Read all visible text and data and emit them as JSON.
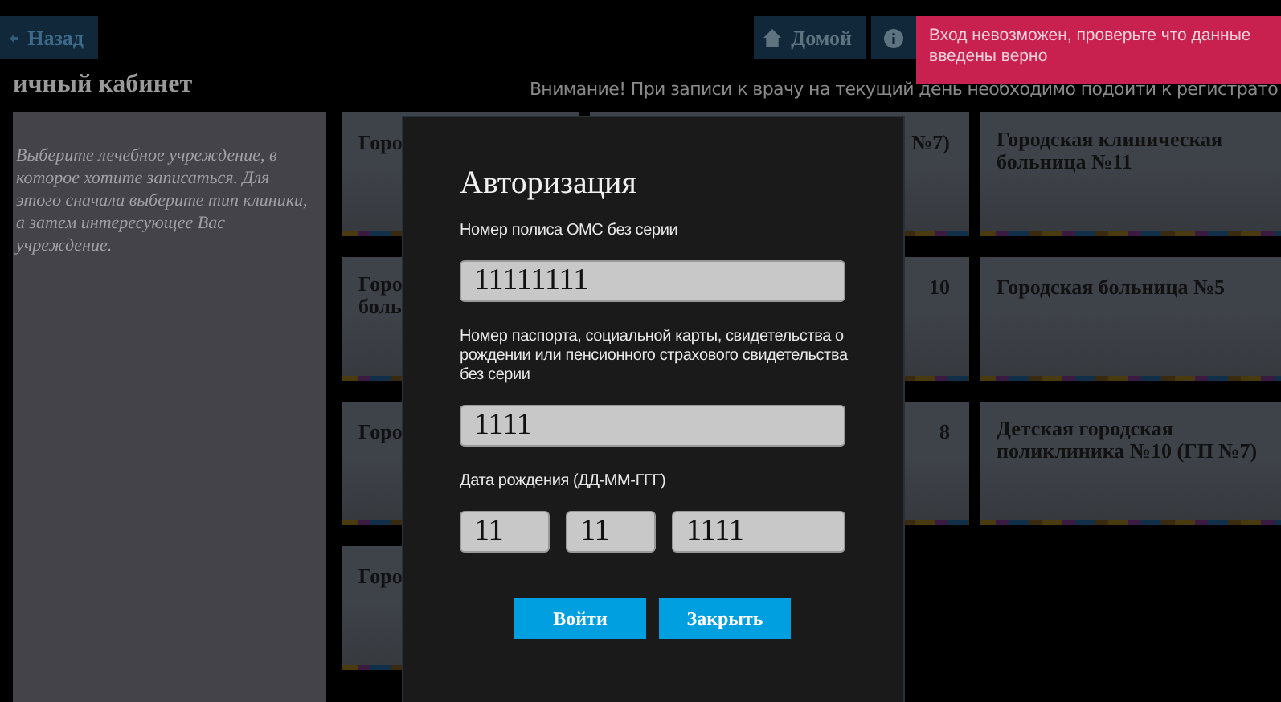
{
  "nav": [
    {
      "kind": "back",
      "label": "Назад"
    },
    {
      "kind": "home",
      "label": "Домой"
    },
    {
      "kind": "info"
    }
  ],
  "header": {
    "title": "ичный кабинет",
    "notice": "Внимание! При записи к врачу на текущий день необходимо подойти к регистрато"
  },
  "sidebar": {
    "text": "Выберите лечебное учреждение, в которое хотите записаться. Для этого сначала выберите тип клиники, а затем интересующее Вас учреждение."
  },
  "tiles": [
    [
      {
        "lines": [
          "Горо"
        ]
      },
      {
        "lines": [
          "№7)"
        ]
      },
      {
        "lines": [
          "Городская клиническая",
          "больница №11"
        ]
      }
    ],
    [
      {
        "lines": [
          "Горо",
          "боль"
        ]
      },
      {
        "lines": [
          "10"
        ]
      },
      {
        "lines": [
          "Городская больница №5"
        ]
      }
    ],
    [
      {
        "lines": [
          "Горо"
        ]
      },
      {
        "lines": [
          "8"
        ]
      },
      {
        "lines": [
          "Детская городская",
          "поликлиника №10 (ГП №7)"
        ]
      }
    ],
    [
      {
        "lines": [
          "Горо"
        ]
      }
    ]
  ],
  "modal": {
    "title": "Авторизация",
    "policy": {
      "label": "Номер полиса ОМС без серии",
      "value": "11111111"
    },
    "passport": {
      "label": "Номер паспорта, социальной карты, свидетельства о рождении или пенсионного страхового свидетельства без серии",
      "value": "1111"
    },
    "birth": {
      "label": "Дата рождения (ДД-ММ-ГГГ)",
      "day": "11",
      "month": "11",
      "year": "1111"
    },
    "buttons": [
      "Войти",
      "Закрыть"
    ]
  },
  "toast": {
    "text": "Вход невозможен, проверьте что данные введены верно"
  }
}
